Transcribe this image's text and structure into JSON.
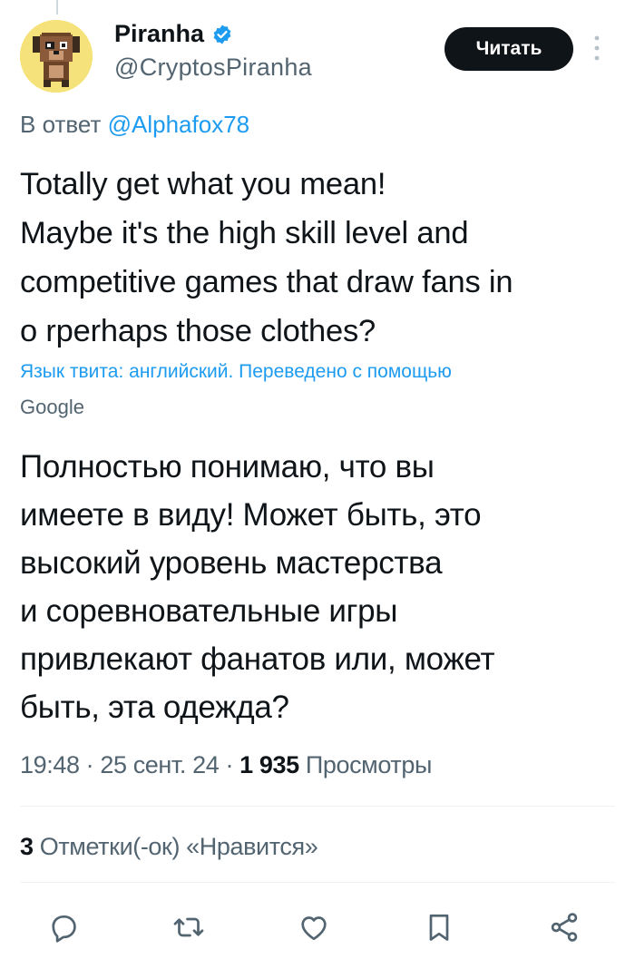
{
  "author": {
    "display_name": "Piranha",
    "handle": "@CryptosPiranha",
    "verified": true
  },
  "follow_button": {
    "label": "Читать"
  },
  "reply_to": {
    "prefix": "В ответ ",
    "mention": "@Alphafox78"
  },
  "tweet": {
    "text": "Totally get what you mean!\nMaybe it's the high skill level and\ncompetitive games that draw fans in\no rperhaps those clothes?"
  },
  "translation": {
    "note": "Язык твита: английский. Переведено с помощью",
    "provider": "Google",
    "text": "Полностью понимаю, что вы\nимеете в виду! Может быть, это\nвысокий уровень мастерства\nи соревновательные игры\nпривлекают фанатов или, может\nбыть, эта одежда?"
  },
  "meta": {
    "time": "19:48",
    "separator": " · ",
    "date": "25 сент. 24",
    "views_count": "1 935",
    "views_label": "Просмотры"
  },
  "likes": {
    "count": "3",
    "label": "Отметки(-ок) «Нравится»"
  },
  "actions": [
    {
      "name": "reply",
      "icon": "reply-icon"
    },
    {
      "name": "retweet",
      "icon": "retweet-icon"
    },
    {
      "name": "like",
      "icon": "heart-icon"
    },
    {
      "name": "bookmark",
      "icon": "bookmark-icon"
    },
    {
      "name": "share",
      "icon": "share-icon"
    }
  ],
  "colors": {
    "accent": "#1d9bf0",
    "text": "#0f1419",
    "secondary": "#536471",
    "avatar_bg": "#f6e27a"
  }
}
